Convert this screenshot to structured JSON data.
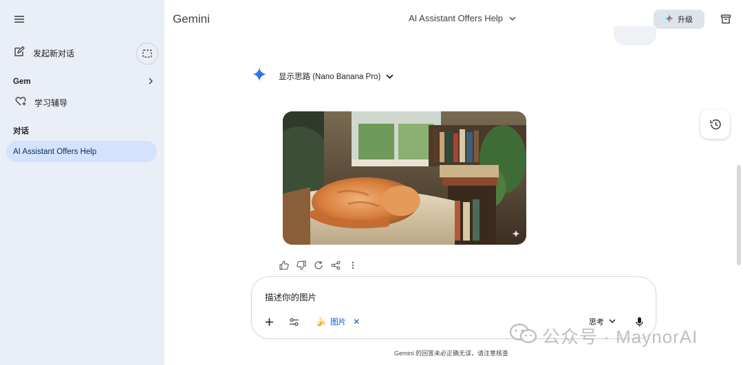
{
  "sidebar": {
    "new_chat_label": "发起新对话",
    "gem_label": "Gem",
    "study_label": "学习辅导",
    "conversations_title": "对话",
    "active_conversation": "AI Assistant Offers Help"
  },
  "header": {
    "brand": "Gemini",
    "conversation_title": "AI Assistant Offers Help",
    "upgrade_label": "升级"
  },
  "response": {
    "thinking_label": "显示思路 (Nano Banana Pro)"
  },
  "composer": {
    "prompt_text": "描述你的图片",
    "chip_label": "图片",
    "chip_emoji": "🍌",
    "mode_label": "思考"
  },
  "footer": {
    "disclaimer": "Gemini 的回答未必正确无误，请注意核查"
  },
  "watermark": {
    "text": "公众号 · MaynorAI"
  },
  "colors": {
    "sidebar_bg": "#eaeef6",
    "active_item_bg": "#d3e3fd",
    "accent_blue": "#0b57d0",
    "upgrade_bg": "#dde3ea"
  },
  "icons": [
    "menu-icon",
    "edit-icon",
    "temporary-chat-icon",
    "chevron-right-icon",
    "gem-heart-icon",
    "chevron-down-icon",
    "sparkle-icon",
    "trash-icon",
    "gemini-star-icon",
    "thumb-up-icon",
    "thumb-down-icon",
    "refresh-icon",
    "share-icon",
    "more-icon",
    "history-icon",
    "plus-icon",
    "tools-icon",
    "close-icon",
    "mic-icon"
  ]
}
